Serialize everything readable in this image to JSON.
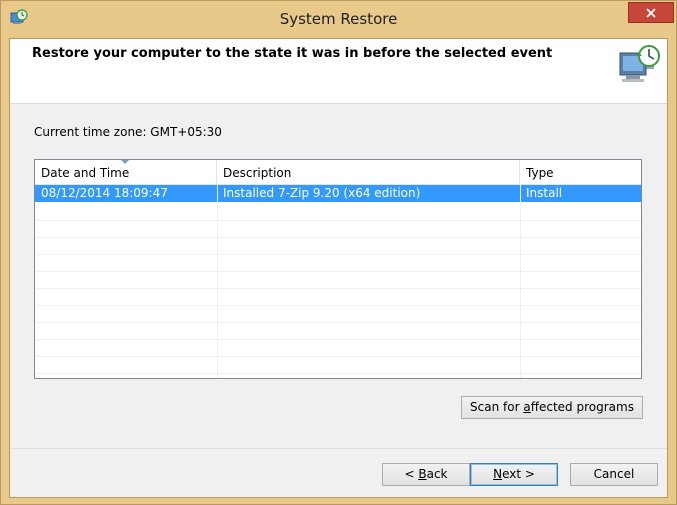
{
  "window": {
    "title": "System Restore"
  },
  "header": {
    "instruction": "Restore your computer to the state it was in before the selected event"
  },
  "timezone": {
    "label": "Current time zone: GMT+05:30"
  },
  "list": {
    "columns": [
      "Date and Time",
      "Description",
      "Type"
    ],
    "sorted_column": "Date and Time",
    "rows": [
      {
        "date": "08/12/2014 18:09:47",
        "description": "Installed 7-Zip 9.20 (x64 edition)",
        "type": "Install",
        "selected": true
      }
    ]
  },
  "buttons": {
    "scan_pre": "Scan for ",
    "scan_accel": "a",
    "scan_post": "ffected programs",
    "back_pre": "< ",
    "back_accel": "B",
    "back_post": "ack",
    "next_accel": "N",
    "next_post": "ext >",
    "cancel": "Cancel"
  },
  "colors": {
    "title_bar": "#e8c98a",
    "close_button": "#c7463a",
    "selection": "#3399ff"
  },
  "icons": {
    "app": "system-restore-icon",
    "header": "computer-restore-icon",
    "close": "close-icon"
  }
}
